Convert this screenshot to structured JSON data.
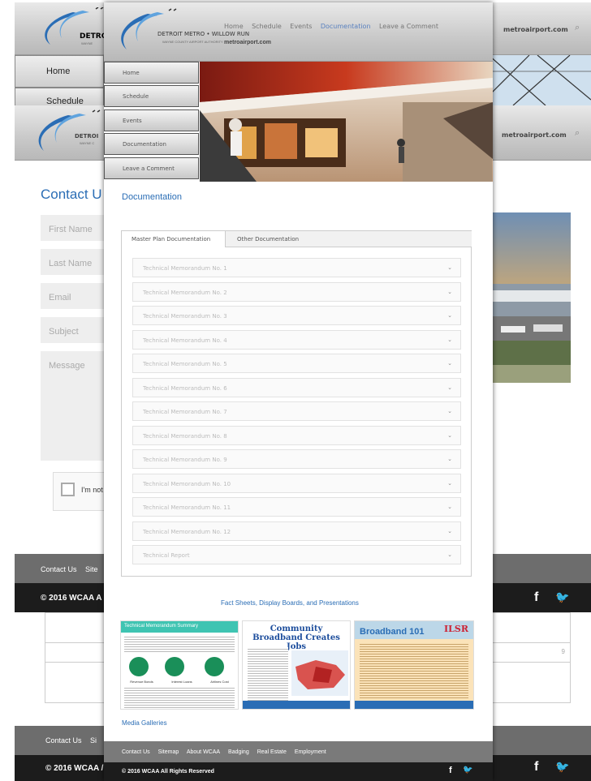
{
  "back_window_top": {
    "site_label": "metroairport.com",
    "menu": [
      "Home",
      "Schedule"
    ]
  },
  "back_window_mid": {
    "site_label": "metroairport.com",
    "logo_text_partial": "DETROI",
    "logo_sub_partial": "WAYNE C",
    "contact_title": "Contact U",
    "fields": {
      "first_name": "First Name",
      "last_name": "Last Name",
      "email": "Email",
      "subject": "Subject",
      "message": "Message"
    },
    "captcha_label": "I'm not",
    "footer_links_partial": [
      "Contact Us",
      "Site"
    ],
    "copyright_partial": "© 2016 WCAA A",
    "side_number": "9"
  },
  "back_window_bottom": {
    "footer_links_partial": [
      "Contact Us",
      "Si"
    ],
    "copyright_partial": "© 2016 WCAA /"
  },
  "front": {
    "brand": "DETROIT METRO • WILLOW RUN",
    "brand_sub": "WAYNE COUNTY AIRPORT AUTHORITY",
    "site_label": "metroairport.com",
    "nav": [
      "Home",
      "Schedule",
      "Events",
      "Documentation",
      "Leave a Comment"
    ],
    "nav_active": "Documentation",
    "side_menu": [
      "Home",
      "Schedule",
      "Events",
      "Documentation",
      "Leave a Comment"
    ],
    "page_title": "Documentation",
    "tabs": [
      "Master Plan Documentation",
      "Other Documentation"
    ],
    "accordion": [
      "Technical Memorandum No. 1",
      "Technical Memorandum No. 2",
      "Technical Memorandum No. 3",
      "Technical Memorandum No. 4",
      "Technical Memorandum No. 5",
      "Technical Memorandum No. 6",
      "Technical Memorandum No. 7",
      "Technical Memorandum No. 8",
      "Technical Memorandum No. 9",
      "Technical Memorandum No. 10",
      "Technical Memorandum No. 11",
      "Technical Memorandum No. 12",
      "Technical Report"
    ],
    "fact_sheets_title": "Fact Sheets, Display Boards, and Presentations",
    "thumb1": {
      "title": "Technical Memorandum Summary",
      "labels": [
        "Revenue Bonds",
        "Interest Loans",
        "Airlines Cost"
      ]
    },
    "thumb2": {
      "title": "Community Broadband Creates Jobs"
    },
    "thumb3": {
      "title": "Broadband 101",
      "logo": "ILSR"
    },
    "media_galleries": "Media Galleries",
    "footer_links": [
      "Contact Us",
      "Sitemap",
      "About WCAA",
      "Badging",
      "Real Estate",
      "Employment"
    ],
    "copyright": "© 2016 WCAA All Rights Reserved"
  },
  "colors": {
    "accent_blue": "#2a6db5",
    "nav_active": "#5a82c0",
    "footer_dark": "#1c1c1c",
    "footer_gray": "#6d6d6d"
  },
  "icons": [
    "search-icon",
    "facebook-icon",
    "twitter-icon",
    "chevron-down-icon"
  ]
}
